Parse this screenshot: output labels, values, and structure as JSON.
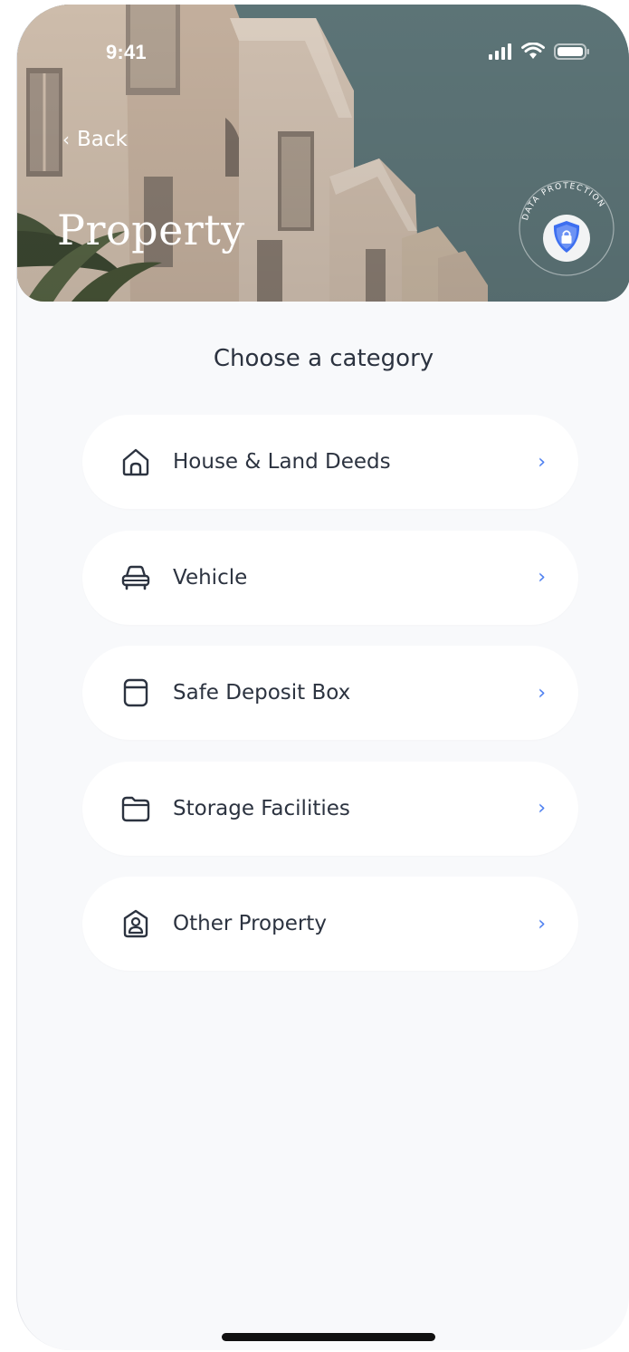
{
  "status_bar": {
    "time": "9:41"
  },
  "nav": {
    "back_label": "Back",
    "title": "Property"
  },
  "badge": {
    "text": "DATA PROTECTION",
    "accent": "#3d6ff0"
  },
  "section_title": "Choose a category",
  "categories": [
    {
      "label": "House & Land Deeds",
      "icon": "house-icon"
    },
    {
      "label": "Vehicle",
      "icon": "car-icon"
    },
    {
      "label": "Safe Deposit Box",
      "icon": "box-icon"
    },
    {
      "label": "Storage Facilities",
      "icon": "folder-icon"
    },
    {
      "label": "Other Property",
      "icon": "user-house-icon"
    }
  ],
  "colors": {
    "background": "#f8f9fb",
    "text": "#2c3340",
    "chevron": "#4d7ff0",
    "card": "#ffffff"
  }
}
